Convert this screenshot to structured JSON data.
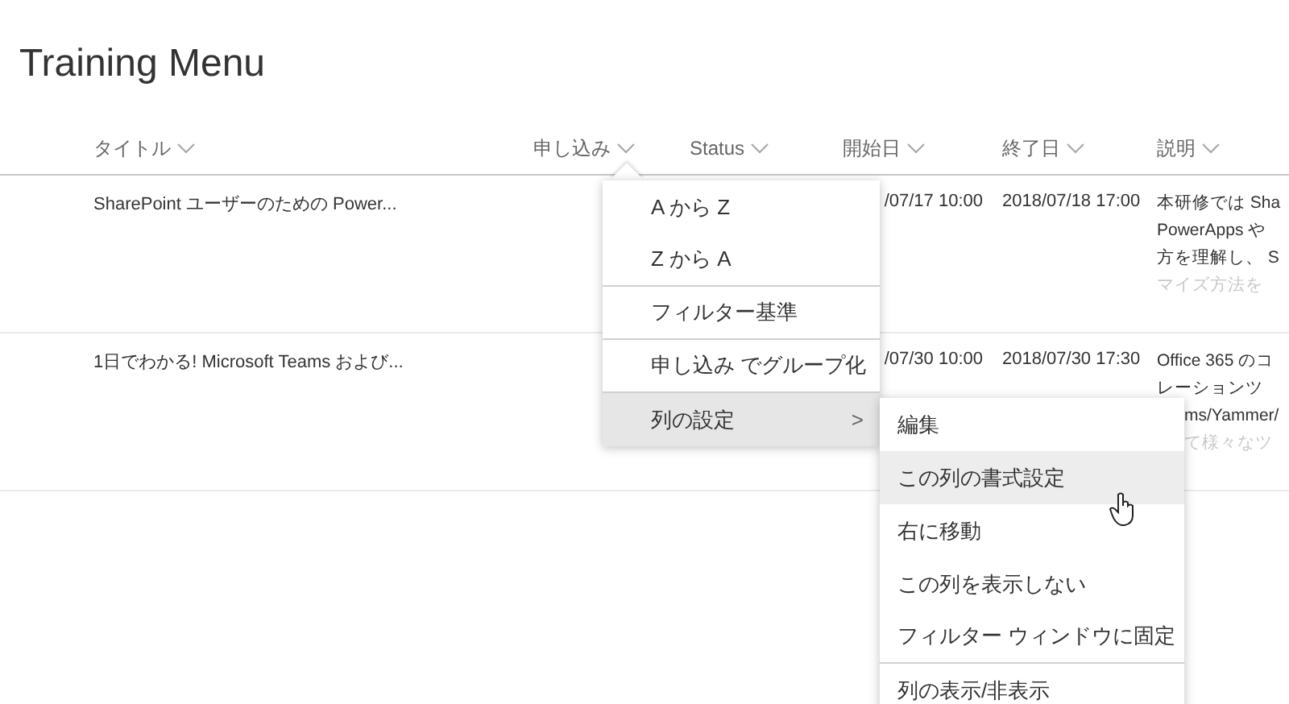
{
  "page_title": "Training Menu",
  "columns": [
    {
      "label": "タイトル"
    },
    {
      "label": "申し込み"
    },
    {
      "label": "Status"
    },
    {
      "label": "開始日"
    },
    {
      "label": "終了日"
    },
    {
      "label": "説明"
    }
  ],
  "rows": [
    {
      "title": "SharePoint ユーザーのための Power...",
      "start": "/07/17 10:00",
      "end": "2018/07/18 17:00",
      "description": [
        {
          "text": "本研修では Sha",
          "covered": false,
          "faded": false
        },
        {
          "text": "PowerApps や",
          "covered": false,
          "faded": false
        },
        {
          "text": "方を理解し、 S",
          "covered": false,
          "faded": false
        },
        {
          "text": "マイズ方法を",
          "covered": false,
          "faded": true
        }
      ]
    },
    {
      "title": "1日でわかる! Microsoft Teams および...",
      "start": "/07/30 10:00",
      "end": "2018/07/30 17:30",
      "description": [
        {
          "text": "Office 365 のコ",
          "covered": false,
          "faded": false
        },
        {
          "text": "レーションツ",
          "covered": false,
          "faded": false
        },
        {
          "text": "ms/Yammer/",
          "covered": true,
          "faded": false
        },
        {
          "text": "て様々なツ",
          "covered": true,
          "faded": true
        }
      ]
    }
  ],
  "column_menu": {
    "items": [
      {
        "label": "A から Z",
        "kind": "item",
        "selected": false,
        "divider_after": false
      },
      {
        "label": "Z から A",
        "kind": "item",
        "selected": false,
        "divider_after": true
      },
      {
        "label": "フィルター基準",
        "kind": "item",
        "selected": false,
        "divider_after": true
      },
      {
        "label": "申し込み でグループ化",
        "kind": "item",
        "selected": false,
        "divider_after": true
      },
      {
        "label": "列の設定",
        "kind": "submenu",
        "selected": true,
        "divider_after": false,
        "chevron": ">"
      }
    ]
  },
  "submenu": {
    "items": [
      {
        "label": "編集",
        "hovered": false,
        "divider_after": false
      },
      {
        "label": "この列の書式設定",
        "hovered": true,
        "divider_after": false
      },
      {
        "label": "右に移動",
        "hovered": false,
        "divider_after": false
      },
      {
        "label": "この列を表示しない",
        "hovered": false,
        "divider_after": false
      },
      {
        "label": "フィルター ウィンドウに固定",
        "hovered": false,
        "divider_after": true
      },
      {
        "label": "列の表示/非表示",
        "hovered": false,
        "divider_after": false
      }
    ]
  }
}
